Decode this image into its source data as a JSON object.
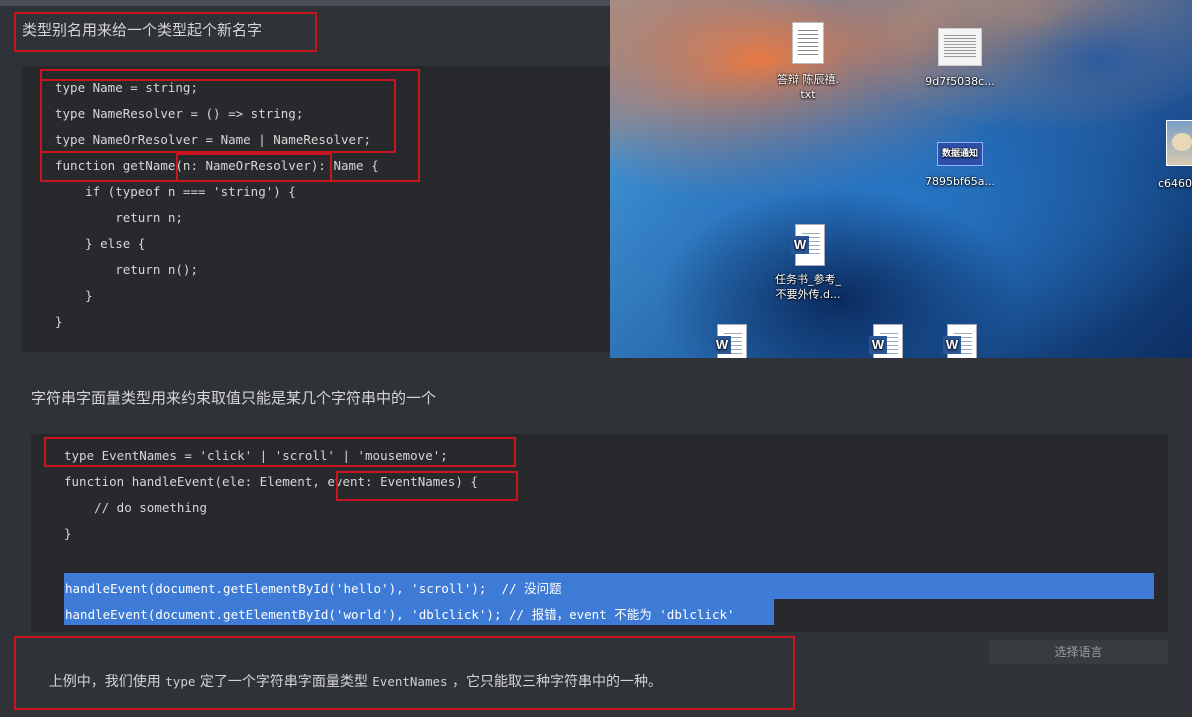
{
  "desktop": {
    "icons": [
      {
        "kind": "txt",
        "label_line1": "答辩 陈辰禧.",
        "label_line2": "txt"
      },
      {
        "kind": "image",
        "label_line1": "9d7f5038c...",
        "label_line2": ""
      },
      {
        "kind": "image-badge",
        "badge_text": "数据通知",
        "label_line1": "7895bf65a...",
        "label_line2": ""
      },
      {
        "kind": "image-cat",
        "label_line1": "c6460",
        "label_line2": ""
      },
      {
        "kind": "word",
        "label_line1": "任务书_参考_",
        "label_line2": "不要外传.d..."
      },
      {
        "kind": "word",
        "label_line1": "",
        "label_line2": ""
      },
      {
        "kind": "word",
        "label_line1": "",
        "label_line2": ""
      },
      {
        "kind": "word",
        "label_line1": "",
        "label_line2": ""
      }
    ]
  },
  "section1": {
    "heading": "类型别名用来给一个类型起个新名字",
    "code_lines": [
      "type Name = string;",
      "type NameResolver = () => string;",
      "type NameOrResolver = Name | NameResolver;",
      "function getName(n: NameOrResolver): Name {",
      "    if (typeof n === 'string') {",
      "        return n;",
      "    } else {",
      "        return n();",
      "    }",
      "}"
    ]
  },
  "section2": {
    "heading": "字符串字面量类型用来约束取值只能是某几个字符串中的一个",
    "code_lines": [
      "type EventNames = 'click' | 'scroll' | 'mousemove';",
      "function handleEvent(ele: Element, event: EventNames) {",
      "    // do something",
      "}",
      "",
      "handleEvent(document.getElementById('hello'), 'scroll');  // 没问题",
      "handleEvent(document.getElementById('world'), 'dblclick'); // 报错，event 不能为 'dblclick'"
    ],
    "language_button": "选择语言",
    "note": {
      "part1": "上例中，我们使用 ",
      "code1": "type",
      "part2": " 定了一个字符串字面量类型 ",
      "code2": "EventNames",
      "part3": " ，它只能取三种字符串中的一种。"
    }
  },
  "colors": {
    "annotation_box": "#c8141e",
    "selection": "#3d7bd6",
    "code_bg": "#27292d",
    "panel_bg": "#2f3236"
  }
}
